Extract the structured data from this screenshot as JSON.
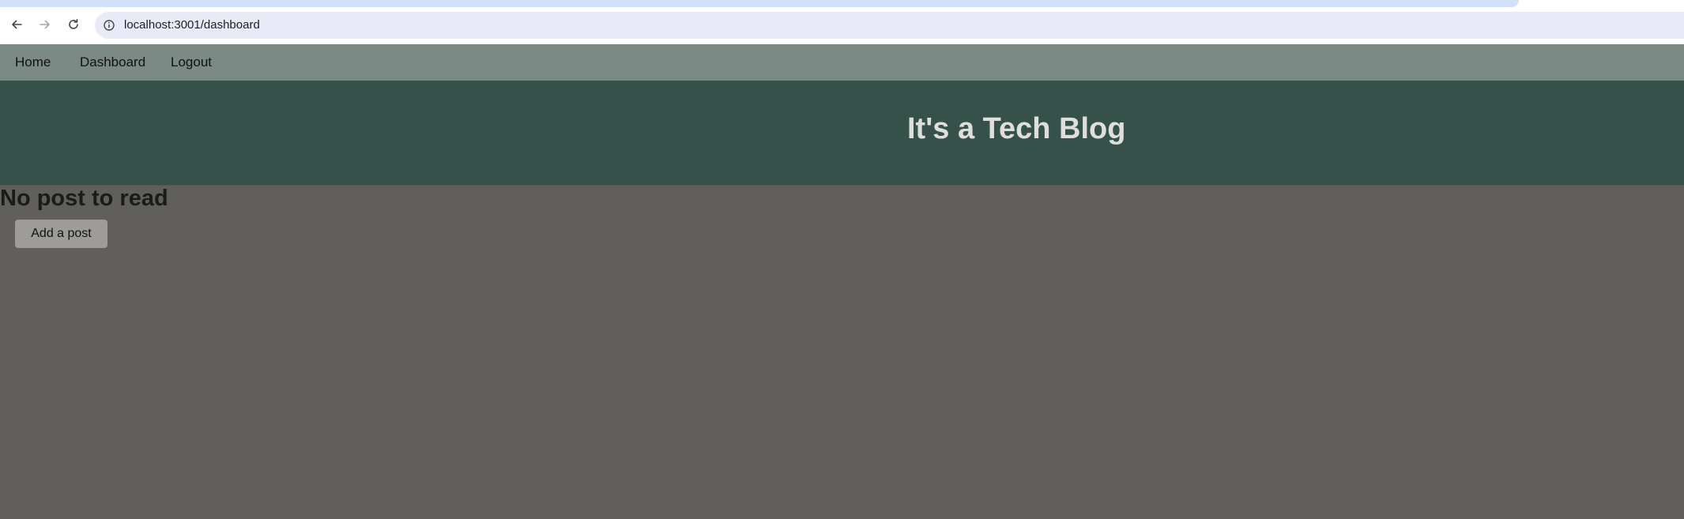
{
  "browser": {
    "url": "localhost:3001/dashboard",
    "back_icon": "arrow-left-icon",
    "forward_icon": "arrow-right-icon",
    "reload_icon": "reload-icon",
    "site_info_icon": "info-icon"
  },
  "nav": {
    "home": "Home",
    "dashboard": "Dashboard",
    "logout": "Logout"
  },
  "header": {
    "title": "It's a Tech Blog"
  },
  "main": {
    "empty_message": "No post to read",
    "add_post_label": "Add a post"
  },
  "colors": {
    "page_bg": "#605f5b",
    "nav_bg": "#7b8a84",
    "header_bg": "#36504a",
    "header_text": "#dedede",
    "button_bg": "#9d9c98"
  }
}
